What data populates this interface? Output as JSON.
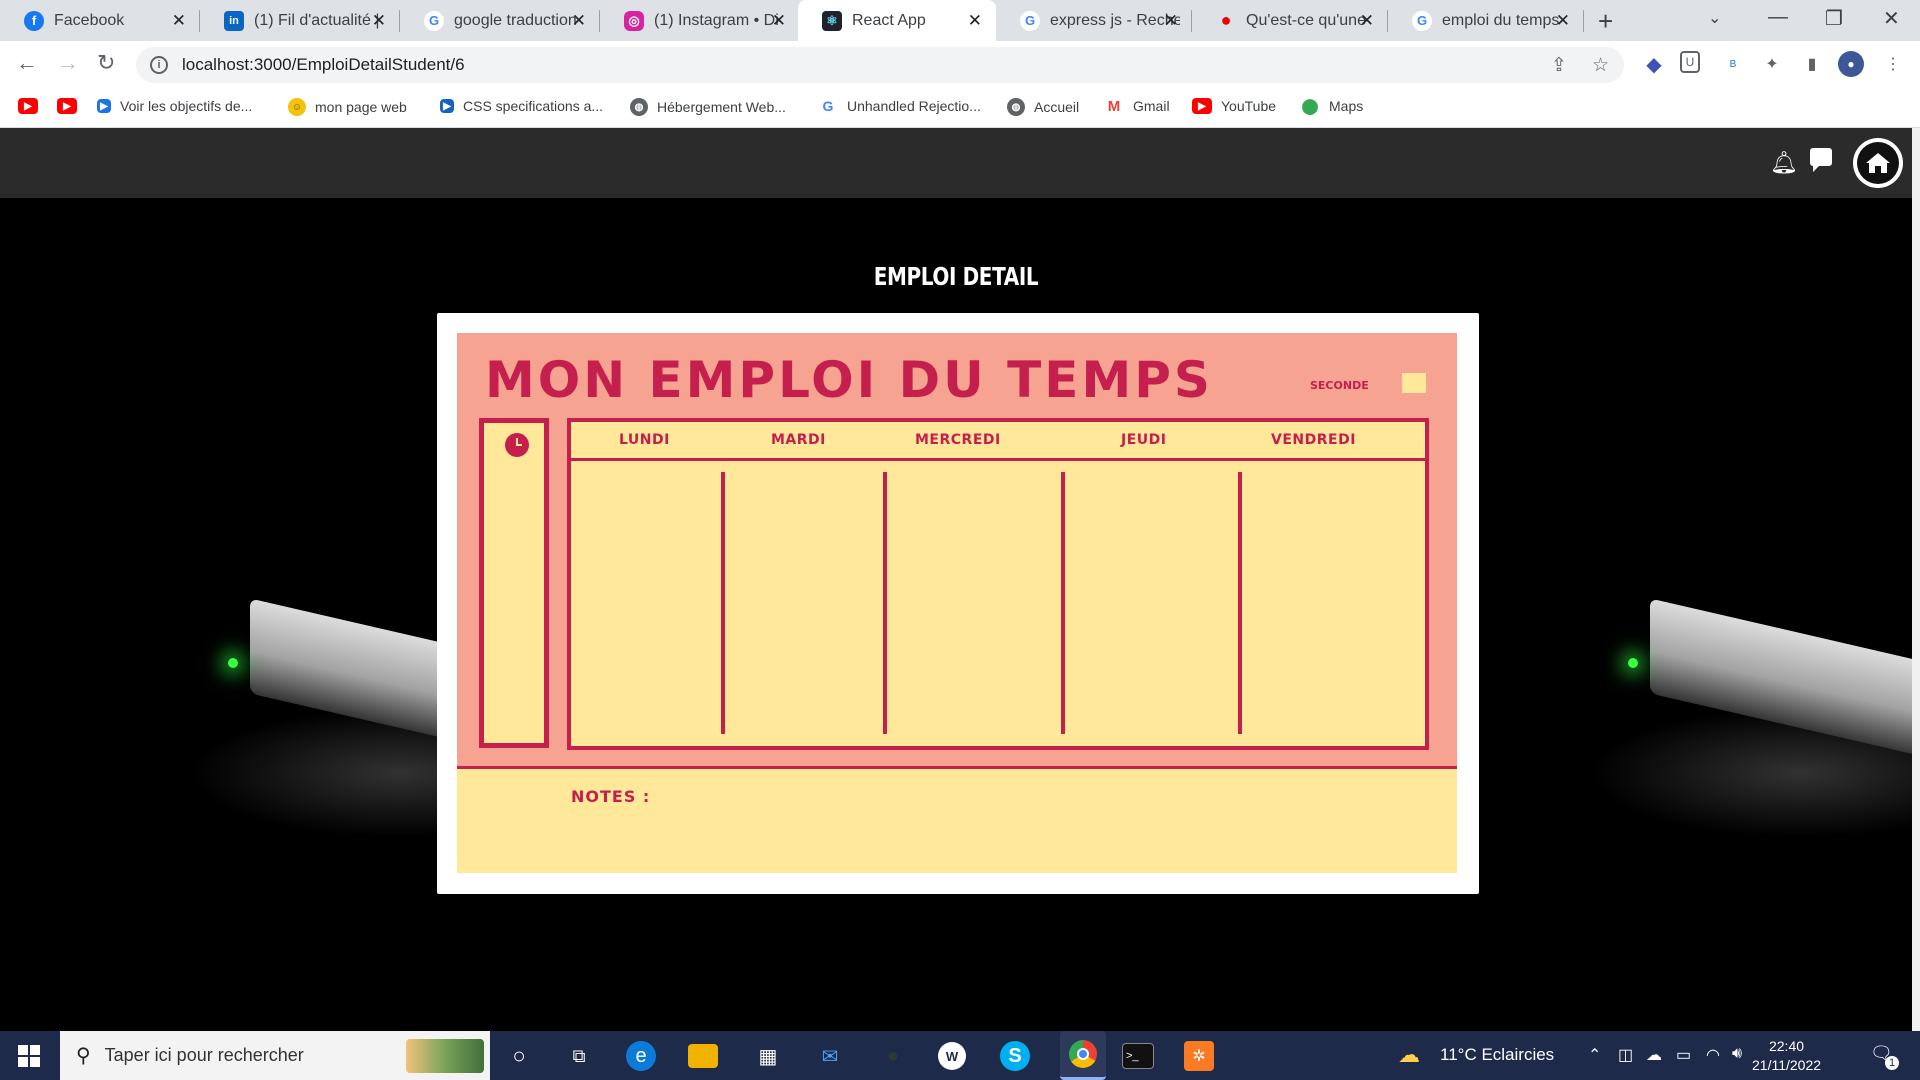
{
  "browser": {
    "tabs": [
      {
        "label": "Facebook",
        "icon": "facebook-icon",
        "color": "#1877f2",
        "glyph": "f"
      },
      {
        "label": "(1) Fil d'actualité |",
        "icon": "linkedin-icon",
        "color": "#0a66c2",
        "glyph": "in"
      },
      {
        "label": "google traduction",
        "icon": "google-icon",
        "color": "#4285f4",
        "glyph": "G"
      },
      {
        "label": "(1) Instagram • Di",
        "icon": "instagram-icon",
        "color": "#d6249f",
        "glyph": "◎"
      },
      {
        "label": "React App",
        "icon": "react-icon",
        "color": "#20232a",
        "glyph": "⚛"
      },
      {
        "label": "express js - Reche",
        "icon": "google-icon",
        "color": "#4285f4",
        "glyph": "G"
      },
      {
        "label": "Qu'est-ce qu'une",
        "icon": "redhat-icon",
        "color": "#ee0000",
        "glyph": "●"
      },
      {
        "label": "emploi du temps",
        "icon": "google-icon",
        "color": "#4285f4",
        "glyph": "G"
      }
    ],
    "url": "localhost:3000/EmploiDetailStudent/6",
    "bookmarks": [
      {
        "label": "",
        "icon": "youtube-icon",
        "color": "#ff0000"
      },
      {
        "label": "",
        "icon": "youtube-icon",
        "color": "#ff0000"
      },
      {
        "label": "Voir les objectifs de...",
        "icon": "ads-icon",
        "color": "#1a73e8"
      },
      {
        "label": "mon page web",
        "icon": "emoji-icon",
        "color": "#f4c20d"
      },
      {
        "label": "CSS specifications a...",
        "icon": "css-icon",
        "color": "#1565c0"
      },
      {
        "label": "Hébergement Web...",
        "icon": "globe-icon",
        "color": "#5f6368"
      },
      {
        "label": "Unhandled Rejectio...",
        "icon": "google-icon",
        "color": "#4285f4"
      },
      {
        "label": "Accueil",
        "icon": "globe-icon",
        "color": "#5f6368"
      },
      {
        "label": "Gmail",
        "icon": "gmail-icon",
        "color": "#ea4335"
      },
      {
        "label": "YouTube",
        "icon": "youtube-icon",
        "color": "#ff0000"
      },
      {
        "label": "Maps",
        "icon": "maps-icon",
        "color": "#34a853"
      }
    ]
  },
  "page": {
    "heading": "EMPLOI DETAIL",
    "timetable": {
      "title": "MON EMPLOI DU TEMPS",
      "seconde": "SECONDE",
      "days": [
        "LUNDI",
        "MARDI",
        "MERCREDI",
        "JEUDI",
        "VENDREDI"
      ],
      "notes_label": "NOTES :",
      "colors": {
        "background": "#f6a391",
        "accent": "#c51f4e",
        "paper": "#ffe89a"
      }
    }
  },
  "taskbar": {
    "search_placeholder": "Taper ici pour rechercher",
    "weather": "11°C  Eclaircies",
    "time": "22:40",
    "date": "21/11/2022",
    "notifications": "1"
  }
}
